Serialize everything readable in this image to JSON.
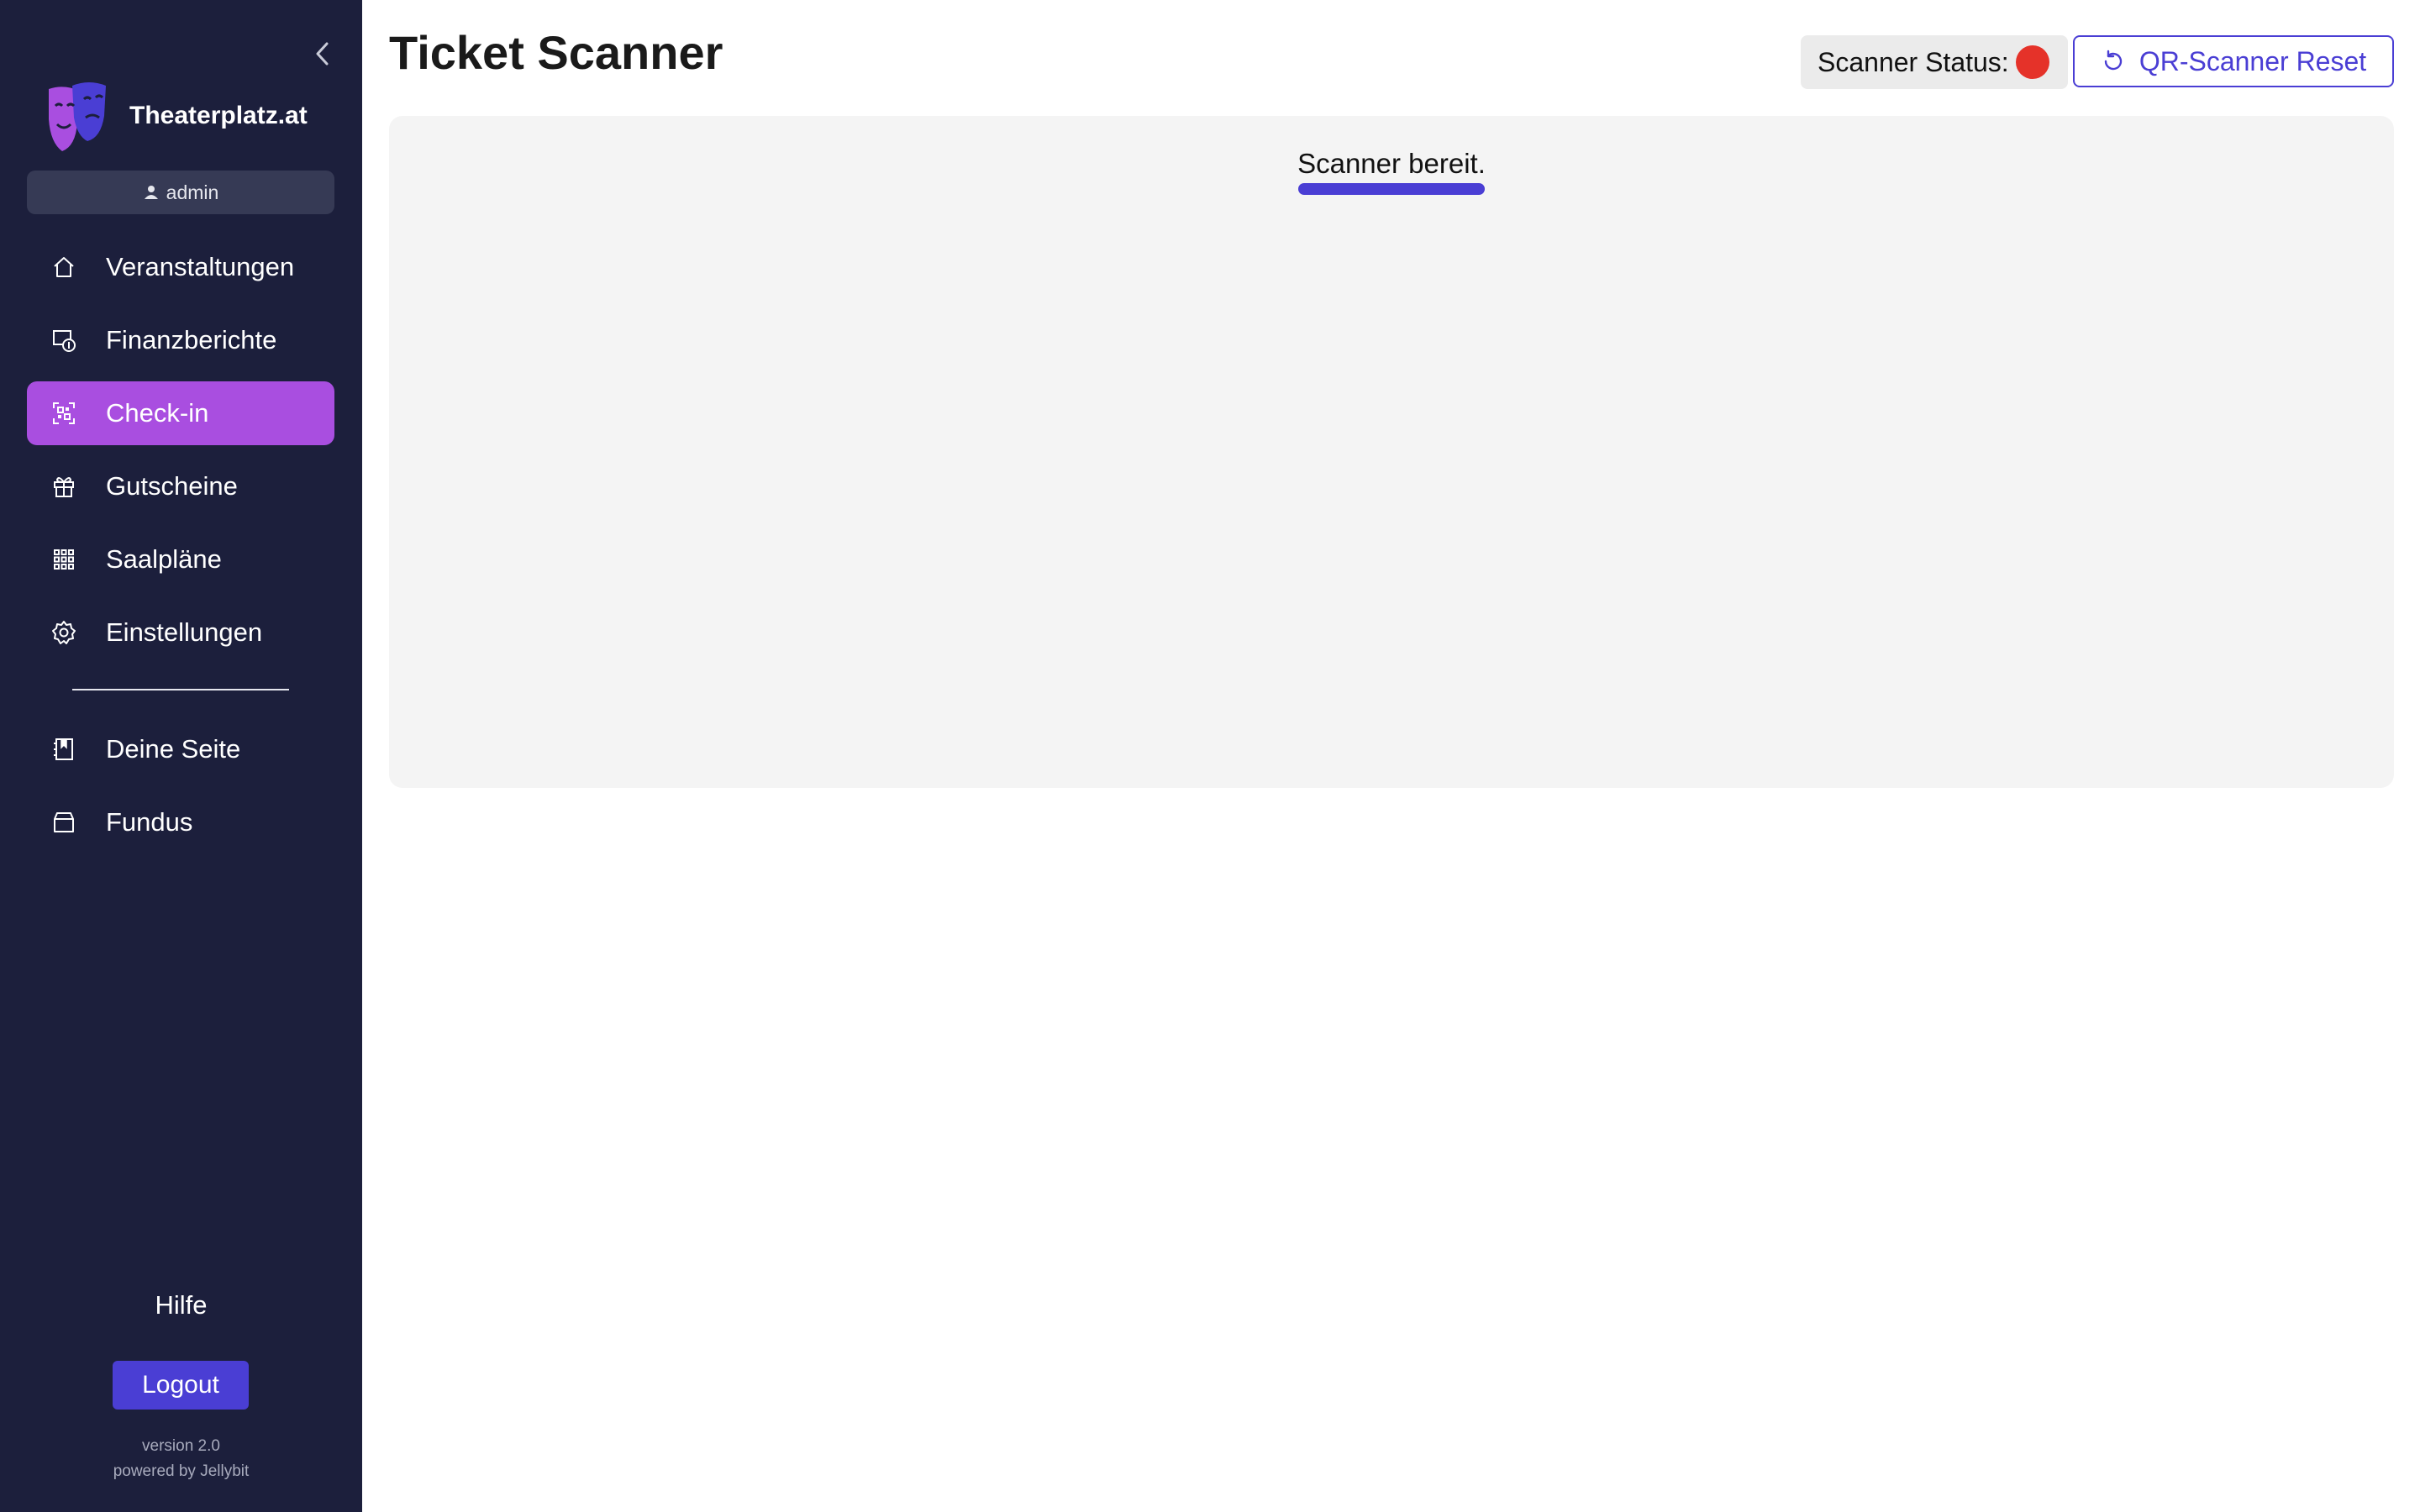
{
  "app": {
    "brand_name": "Theaterplatz.at",
    "user": "admin",
    "colors": {
      "sidebar_bg": "#1c1f3c",
      "active_item": "#a94ee0",
      "accent": "#4a3ed4",
      "status_offline": "#e53229"
    }
  },
  "sidebar": {
    "collapse_icon": "chevron-left-icon",
    "items": [
      {
        "label": "Veranstaltungen",
        "icon": "home-icon",
        "active": false
      },
      {
        "label": "Finanzberichte",
        "icon": "finance-report-icon",
        "active": false
      },
      {
        "label": "Check-in",
        "icon": "qr-scan-icon",
        "active": true
      },
      {
        "label": "Gutscheine",
        "icon": "gift-icon",
        "active": false
      },
      {
        "label": "Saalpläne",
        "icon": "grid-icon",
        "active": false
      },
      {
        "label": "Einstellungen",
        "icon": "gear-icon",
        "active": false
      }
    ],
    "secondary_items": [
      {
        "label": "Deine Seite",
        "icon": "page-bookmark-icon"
      },
      {
        "label": "Fundus",
        "icon": "box-icon"
      }
    ],
    "help_label": "Hilfe",
    "logout_label": "Logout",
    "version": "version 2.0",
    "powered_by": "powered by Jellybit"
  },
  "main": {
    "title": "Ticket Scanner",
    "scanner_status_label": "Scanner Status:",
    "reset_label": "QR-Scanner Reset",
    "scanner_message": "Scanner bereit."
  }
}
